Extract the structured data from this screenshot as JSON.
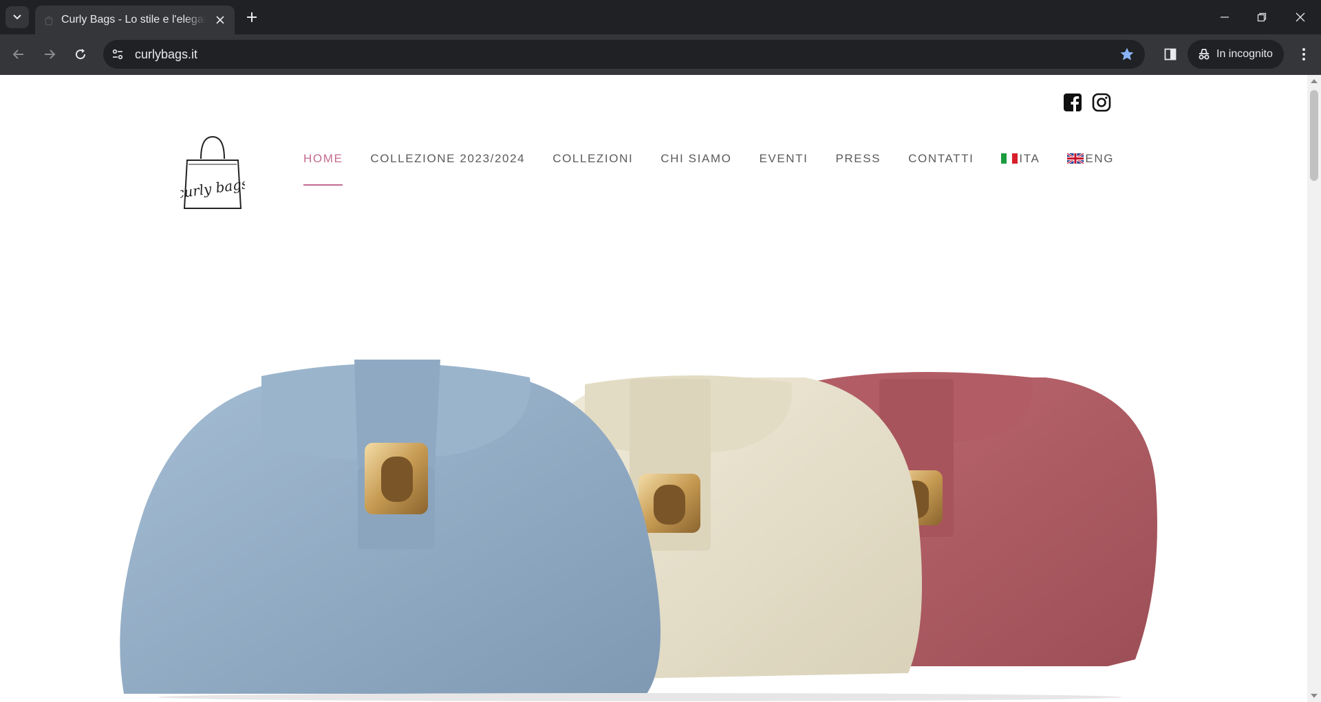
{
  "browser": {
    "tab_title": "Curly Bags - Lo stile e l'eleganza",
    "url": "curlybags.it",
    "incognito_label": "In incognito"
  },
  "site": {
    "logo_text": "curly bags",
    "nav": [
      {
        "label": "HOME",
        "active": true
      },
      {
        "label": "COLLEZIONE 2023/2024"
      },
      {
        "label": "COLLEZIONI"
      },
      {
        "label": "CHI SIAMO"
      },
      {
        "label": "EVENTI"
      },
      {
        "label": "PRESS"
      },
      {
        "label": "CONTATTI"
      },
      {
        "label": "ITA",
        "flag": "italy-flag-icon"
      },
      {
        "label": "ENG",
        "flag": "uk-flag-icon"
      }
    ],
    "social": [
      "facebook-icon",
      "instagram-icon"
    ],
    "colors": {
      "accent": "#c26a8e",
      "nav_text": "#5b5b5b",
      "bag_blue": "#90aac4",
      "bag_cream": "#e6dfc8",
      "bag_rose": "#b05b62"
    }
  }
}
